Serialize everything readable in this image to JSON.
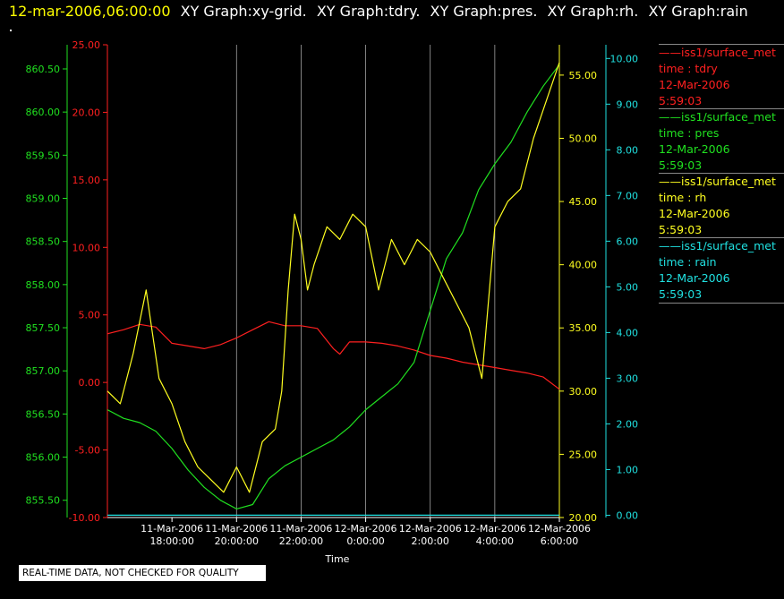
{
  "header": {
    "datetime": "12-mar-2006,06:00:00",
    "graph_titles": [
      "XY Graph:xy-grid.",
      "XY Graph:tdry.",
      "XY Graph:pres.",
      "XY Graph:rh.",
      "XY Graph:rain"
    ]
  },
  "colors": {
    "tdry": "#ff2020",
    "pres": "#20e020",
    "rh": "#ffff20",
    "rain": "#20e0e0",
    "grid": "#cccccc",
    "background": "#000000"
  },
  "legend": [
    {
      "line": "——iss1/surface_met",
      "var": "time : tdry",
      "date": "12-Mar-2006",
      "time": "5:59:03",
      "color": "#ff2020"
    },
    {
      "line": "——iss1/surface_met",
      "var": "time : pres",
      "date": "12-Mar-2006",
      "time": "5:59:03",
      "color": "#20e020"
    },
    {
      "line": "——iss1/surface_met",
      "var": "time : rh",
      "date": "12-Mar-2006",
      "time": "5:59:03",
      "color": "#ffff20"
    },
    {
      "line": "——iss1/surface_met",
      "var": "time : rain",
      "date": "12-Mar-2006",
      "time": "5:59:03",
      "color": "#20e0e0"
    }
  ],
  "footer": {
    "quality_note": "REAL-TIME DATA, NOT CHECKED FOR QUALITY"
  },
  "chart_data": {
    "type": "line",
    "xlabel": "Time",
    "x_ticks": [
      [
        "11-Mar-2006",
        "18:00:00"
      ],
      [
        "11-Mar-2006",
        "20:00:00"
      ],
      [
        "11-Mar-2006",
        "22:00:00"
      ],
      [
        "12-Mar-2006",
        "0:00:00"
      ],
      [
        "12-Mar-2006",
        "2:00:00"
      ],
      [
        "12-Mar-2006",
        "4:00:00"
      ],
      [
        "12-Mar-2006",
        "6:00:00"
      ]
    ],
    "x_range_hours_from_1800": [
      -2.0,
      12.0
    ],
    "grid": "vertical",
    "axes": {
      "pres": {
        "ticks": [
          "860.50",
          "860.00",
          "859.50",
          "859.00",
          "858.50",
          "858.00",
          "857.50",
          "857.00",
          "856.50",
          "856.00",
          "855.50"
        ],
        "range": [
          855.3,
          860.78
        ]
      },
      "tdry": {
        "ticks": [
          "25.00",
          "20.00",
          "15.00",
          "10.00",
          "5.00",
          "0.00",
          "-5.00",
          "-10.00"
        ],
        "range": [
          -10,
          25
        ]
      },
      "rh": {
        "ticks": [
          "55.00",
          "50.00",
          "45.00",
          "40.00",
          "35.00",
          "30.00",
          "25.00",
          "20.00"
        ],
        "range": [
          20,
          57.4
        ]
      },
      "rain": {
        "ticks": [
          "10.00",
          "9.00",
          "8.00",
          "7.00",
          "6.00",
          "5.00",
          "4.00",
          "3.00",
          "2.00",
          "1.00",
          "0.00"
        ],
        "range": [
          -0.05,
          10.3
        ]
      }
    },
    "series": [
      {
        "name": "tdry",
        "axis": "tdry",
        "x": [
          -2.0,
          -1.5,
          -1.0,
          -0.5,
          0.0,
          0.5,
          1.0,
          1.5,
          2.0,
          2.5,
          3.0,
          3.5,
          4.0,
          4.5,
          5.0,
          5.2,
          5.5,
          6.0,
          6.5,
          7.0,
          7.5,
          8.0,
          8.5,
          9.0,
          9.5,
          10.0,
          10.5,
          11.0,
          11.5,
          12.0
        ],
        "y": [
          3.6,
          3.9,
          4.3,
          4.1,
          2.9,
          2.7,
          2.5,
          2.8,
          3.3,
          3.9,
          4.5,
          4.2,
          4.2,
          4.0,
          2.5,
          2.1,
          3.0,
          3.0,
          2.9,
          2.7,
          2.4,
          2.0,
          1.8,
          1.5,
          1.3,
          1.1,
          0.9,
          0.7,
          0.4,
          -0.5
        ]
      },
      {
        "name": "pres",
        "axis": "pres",
        "x": [
          -2.0,
          -1.5,
          -1.0,
          -0.5,
          0.0,
          0.5,
          1.0,
          1.5,
          2.0,
          2.5,
          3.0,
          3.5,
          4.0,
          4.5,
          5.0,
          5.5,
          6.0,
          6.5,
          7.0,
          7.5,
          8.0,
          8.5,
          9.0,
          9.5,
          10.0,
          10.5,
          11.0,
          11.5,
          12.0
        ],
        "y": [
          856.55,
          856.45,
          856.4,
          856.3,
          856.1,
          855.85,
          855.65,
          855.5,
          855.4,
          855.45,
          855.75,
          855.9,
          856.0,
          856.1,
          856.2,
          856.35,
          856.55,
          856.7,
          856.85,
          857.1,
          857.7,
          858.3,
          858.6,
          859.1,
          859.4,
          859.65,
          860.0,
          860.3,
          860.55
        ]
      },
      {
        "name": "rh",
        "axis": "rh",
        "x": [
          -2.0,
          -1.6,
          -1.2,
          -0.8,
          -0.4,
          0.0,
          0.4,
          0.8,
          1.2,
          1.6,
          2.0,
          2.4,
          2.8,
          3.2,
          3.4,
          3.6,
          3.8,
          4.0,
          4.2,
          4.4,
          4.8,
          5.2,
          5.6,
          6.0,
          6.4,
          6.8,
          7.2,
          7.6,
          8.0,
          8.4,
          8.8,
          9.2,
          9.6,
          10.0,
          10.4,
          10.8,
          11.2,
          11.6,
          12.0
        ],
        "y": [
          30,
          29,
          33,
          38,
          31,
          29,
          26,
          24,
          23,
          22,
          24,
          22,
          26,
          27,
          30,
          38,
          44,
          42,
          38,
          40,
          43,
          42,
          44,
          43,
          38,
          42,
          40,
          42,
          41,
          39,
          37,
          35,
          31,
          43,
          45,
          46,
          50,
          53,
          56
        ]
      },
      {
        "name": "rain",
        "axis": "rain",
        "x": [
          -2.0,
          12.0
        ],
        "y": [
          0.0,
          0.0
        ]
      }
    ]
  }
}
